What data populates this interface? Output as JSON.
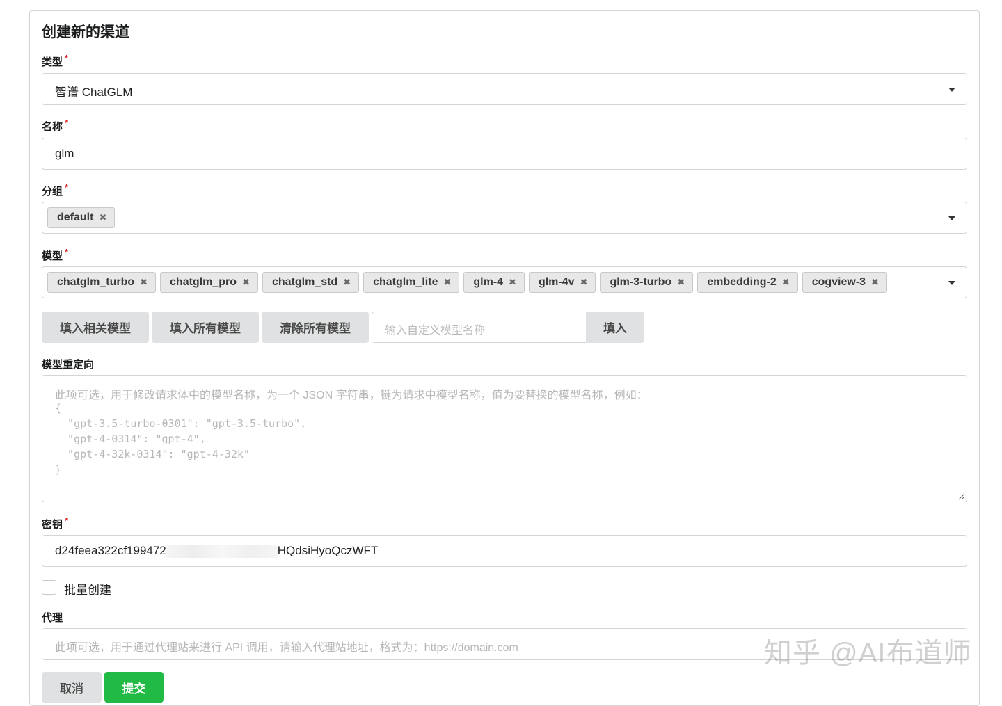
{
  "form": {
    "title": "创建新的渠道",
    "required_mark": "*",
    "type": {
      "label": "类型",
      "value": "智谱 ChatGLM"
    },
    "name": {
      "label": "名称",
      "value": "glm"
    },
    "group": {
      "label": "分组",
      "chips": [
        "default"
      ]
    },
    "models": {
      "label": "模型",
      "chips": [
        "chatglm_turbo",
        "chatglm_pro",
        "chatglm_std",
        "chatglm_lite",
        "glm-4",
        "glm-4v",
        "glm-3-turbo",
        "embedding-2",
        "cogview-3"
      ]
    },
    "model_buttons": {
      "fill_related": "填入相关模型",
      "fill_all": "填入所有模型",
      "clear_all": "清除所有模型",
      "custom_placeholder": "输入自定义模型名称",
      "fill": "填入"
    },
    "model_mapping": {
      "label": "模型重定向",
      "placeholder_lines": [
        "此项可选，用于修改请求体中的模型名称，为一个 JSON 字符串，键为请求中模型名称，值为要替换的模型名称，例如：",
        "{",
        "  \"gpt-3.5-turbo-0301\": \"gpt-3.5-turbo\",",
        "  \"gpt-4-0314\": \"gpt-4\",",
        "  \"gpt-4-32k-0314\": \"gpt-4-32k\"",
        "}"
      ]
    },
    "key": {
      "label": "密钥",
      "value_start": "d24feea322cf199472",
      "value_end": "HQdsiHyoQczWFT"
    },
    "batch": {
      "label": "批量创建",
      "checked": false
    },
    "proxy": {
      "label": "代理",
      "placeholder": "此项可选，用于通过代理站来进行 API 调用，请输入代理站地址，格式为：https://domain.com"
    },
    "cancel_label": "取消",
    "submit_label": "提交"
  },
  "watermark": "知乎 @AI布道师",
  "colors": {
    "submit": "#21ba45",
    "required": "#db2828",
    "button_gray": "#e0e1e2"
  }
}
